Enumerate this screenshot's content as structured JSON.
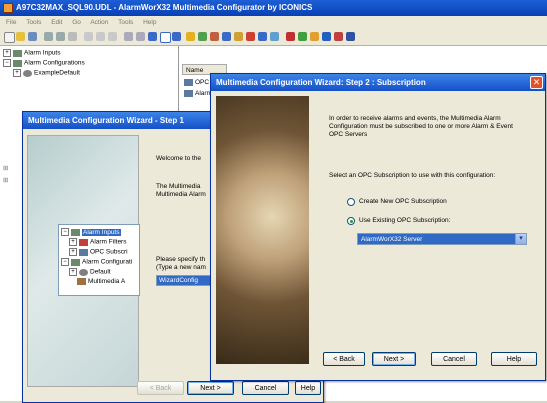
{
  "app": {
    "title": "A97C32MAX_SQL90.UDL - AlarmWorX32 Multimedia Configurator by ICONICS",
    "menu": [
      "File",
      "Tools",
      "Edit",
      "Go",
      "Action",
      "Tools",
      "Help"
    ]
  },
  "tree": {
    "items": [
      {
        "label": "Alarm Inputs"
      },
      {
        "label": "Alarm Configurations"
      },
      {
        "label": "ExampleDefault"
      }
    ]
  },
  "list": {
    "column_name": "Name",
    "items": [
      "OPC",
      "Alarm"
    ]
  },
  "wizard1": {
    "title": "Multimedia Configuration Wizard - Step 1",
    "welcome": "Welcome to the",
    "intro_line1": "The Multimedia",
    "intro_line2": "Multimedia Alarm",
    "specify_line1": "Please specify th",
    "specify_line2": "(Type a new nam",
    "name_value": "WizardConfig",
    "inset_tree": [
      "Alarm Inputs",
      "Alarm Filters",
      "OPC Subscri",
      "Alarm Configurati",
      "Default",
      "Multimedia A"
    ],
    "buttons": {
      "back": "< Back",
      "next": "Next >",
      "cancel": "Cancel",
      "help": "Help"
    }
  },
  "wizard2": {
    "title": "Multimedia Configuration Wizard:  Step 2 : Subscription",
    "info": "In order to receive alarms and events, the Multimedia Alarm Configuration must be subscribed to one or more Alarm & Event OPC Servers",
    "select_prompt": "Select an OPC Subscription to use with this configuration:",
    "option_new": "Create New OPC Subscription",
    "option_existing": "Use Existing OPC Subscription:",
    "selected_subscription": "AlarmWorX32 Server",
    "buttons": {
      "back": "< Back",
      "next": "Next >",
      "cancel": "Cancel",
      "help": "Help"
    }
  }
}
